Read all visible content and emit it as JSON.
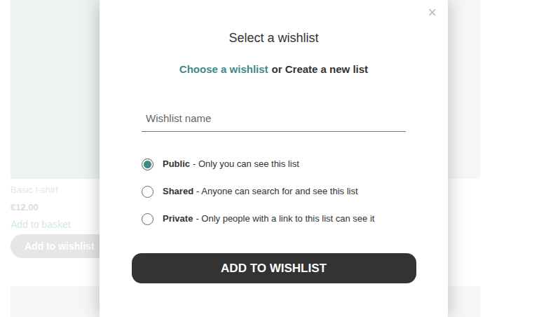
{
  "products": [
    {
      "name": "Basic t-shirt",
      "price": "€12.00",
      "basket": "Add to basket",
      "wishlist": "Add to wishlist"
    },
    {
      "name": "",
      "price": "",
      "basket": "",
      "wishlist": ""
    }
  ],
  "modal": {
    "close": "×",
    "title": "Select a wishlist",
    "choose_link": "Choose a wishlist",
    "create_text": "or Create a new list",
    "input_placeholder": "Wishlist name",
    "radios": [
      {
        "label": "Public",
        "description": "- Only you can see this list",
        "selected": true
      },
      {
        "label": "Shared",
        "description": "- Anyone can search for and see this list",
        "selected": false
      },
      {
        "label": "Private",
        "description": "- Only people with a link to this list can see it",
        "selected": false
      }
    ],
    "submit": "ADD TO WISHLIST"
  }
}
